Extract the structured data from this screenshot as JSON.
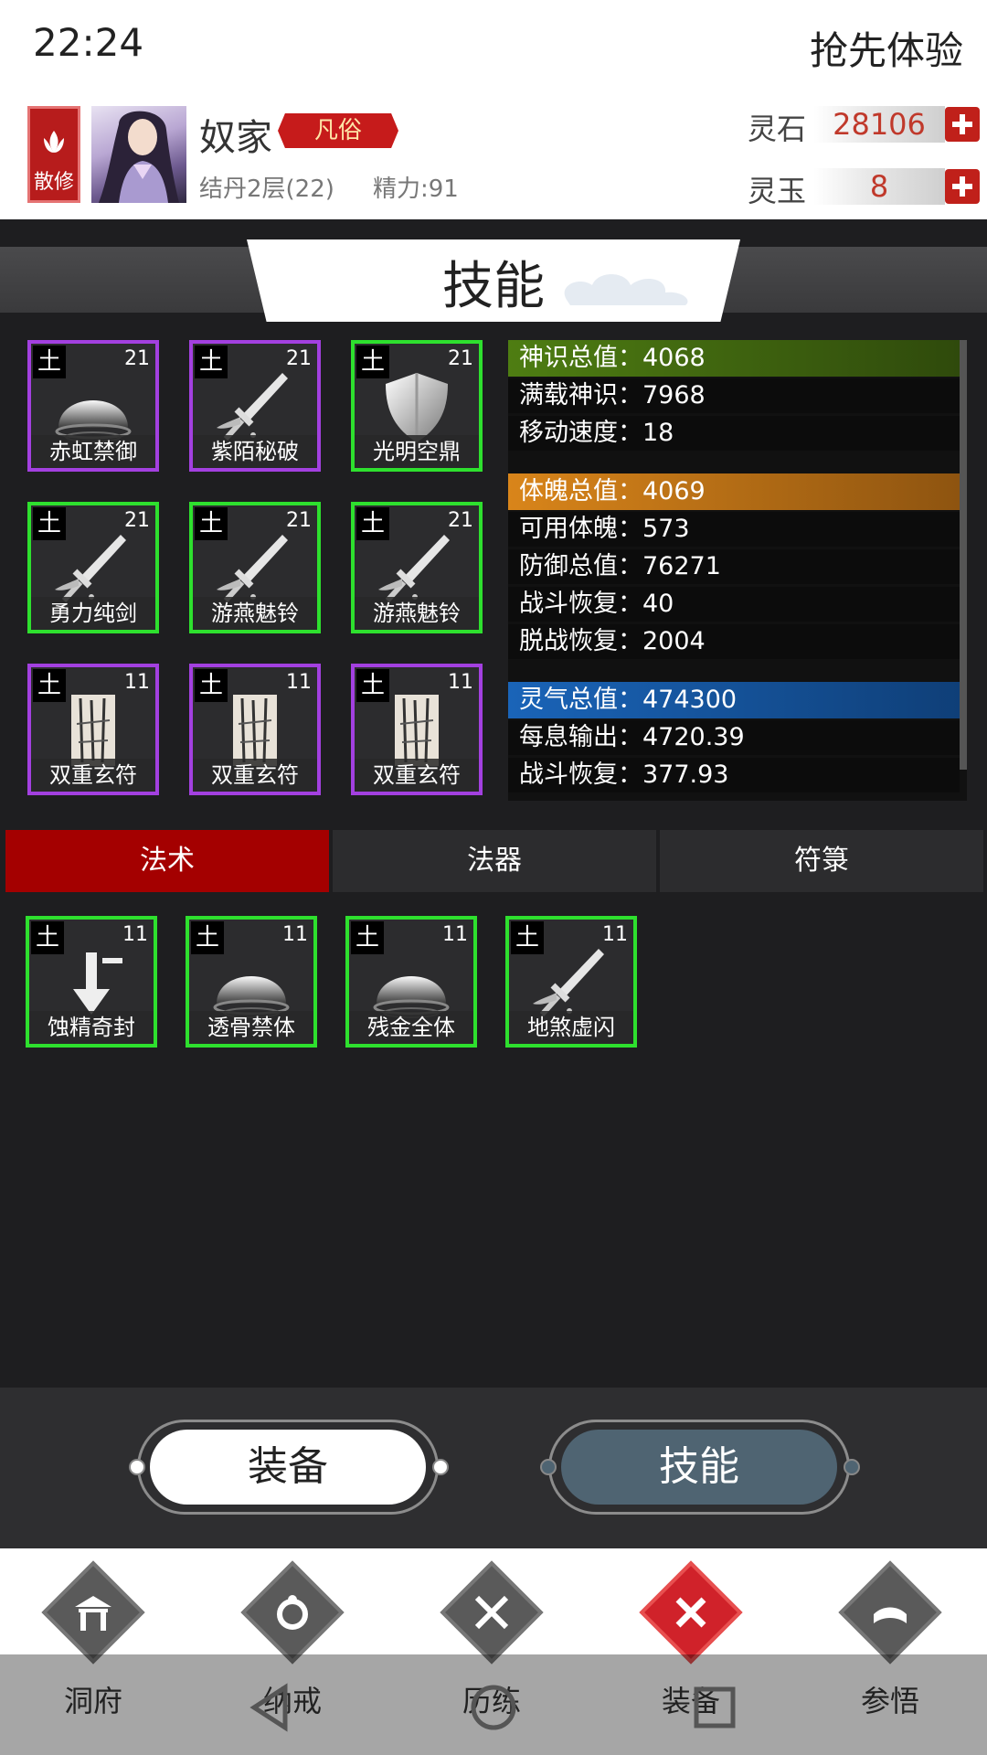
{
  "status_bar": {
    "time": "22:24",
    "promo": "抢先体验"
  },
  "header": {
    "sect_label": "散修",
    "player_name": "奴家",
    "rank_tag": "凡俗",
    "realm": "结丹2层(22)",
    "energy": "精力:91",
    "currencies": [
      {
        "label": "灵石",
        "value": "28106"
      },
      {
        "label": "灵玉",
        "value": "8"
      }
    ]
  },
  "title": "技能",
  "skills": [
    {
      "element": "土",
      "level": "21",
      "name": "赤虹禁御",
      "icon": "dome-shield-icon",
      "rarity": "purple"
    },
    {
      "element": "土",
      "level": "21",
      "name": "紫陌秘破",
      "icon": "sword-icon",
      "rarity": "purple"
    },
    {
      "element": "土",
      "level": "21",
      "name": "光明空鼎",
      "icon": "shield-icon",
      "rarity": "green"
    },
    {
      "element": "土",
      "level": "21",
      "name": "勇力纯剑",
      "icon": "sword-icon",
      "rarity": "green"
    },
    {
      "element": "土",
      "level": "21",
      "name": "游燕魅铃",
      "icon": "sword-icon",
      "rarity": "green"
    },
    {
      "element": "土",
      "level": "21",
      "name": "游燕魅铃",
      "icon": "sword-icon",
      "rarity": "green"
    },
    {
      "element": "土",
      "level": "11",
      "name": "双重玄符",
      "icon": "talisman-icon",
      "rarity": "purple"
    },
    {
      "element": "土",
      "level": "11",
      "name": "双重玄符",
      "icon": "talisman-icon",
      "rarity": "purple"
    },
    {
      "element": "土",
      "level": "11",
      "name": "双重玄符",
      "icon": "talisman-icon",
      "rarity": "purple"
    }
  ],
  "stats": {
    "spirit_head": "神识总值：4068",
    "spirit_rows": [
      "满载神识：7968",
      "移动速度：18"
    ],
    "body_head": "体魄总值：4069",
    "body_rows": [
      "可用体魄：573",
      "防御总值：76271",
      "战斗恢复：40",
      "脱战恢复：2004"
    ],
    "qi_head": "灵气总值：474300",
    "qi_rows": [
      "每息输出：4720.39",
      "战斗恢复：377.93"
    ]
  },
  "colors": {
    "spirit": "#4e7d12",
    "body": "#d9851a",
    "qi": "#1a64b8",
    "active_tab": "#a40000"
  },
  "tabs": [
    "法术",
    "法器",
    "符箓"
  ],
  "spells": [
    {
      "element": "土",
      "level": "11",
      "name": "蚀精奇封",
      "icon": "arrow-down-icon"
    },
    {
      "element": "土",
      "level": "11",
      "name": "透骨禁体",
      "icon": "dome-shield-icon"
    },
    {
      "element": "土",
      "level": "11",
      "name": "残金全体",
      "icon": "dome-shield-icon"
    },
    {
      "element": "土",
      "level": "11",
      "name": "地煞虚闪",
      "icon": "sword-icon"
    }
  ],
  "bottom_buttons": [
    "装备",
    "技能"
  ],
  "nav": [
    "洞府",
    "纳戒",
    "历练",
    "装备",
    "参悟"
  ]
}
